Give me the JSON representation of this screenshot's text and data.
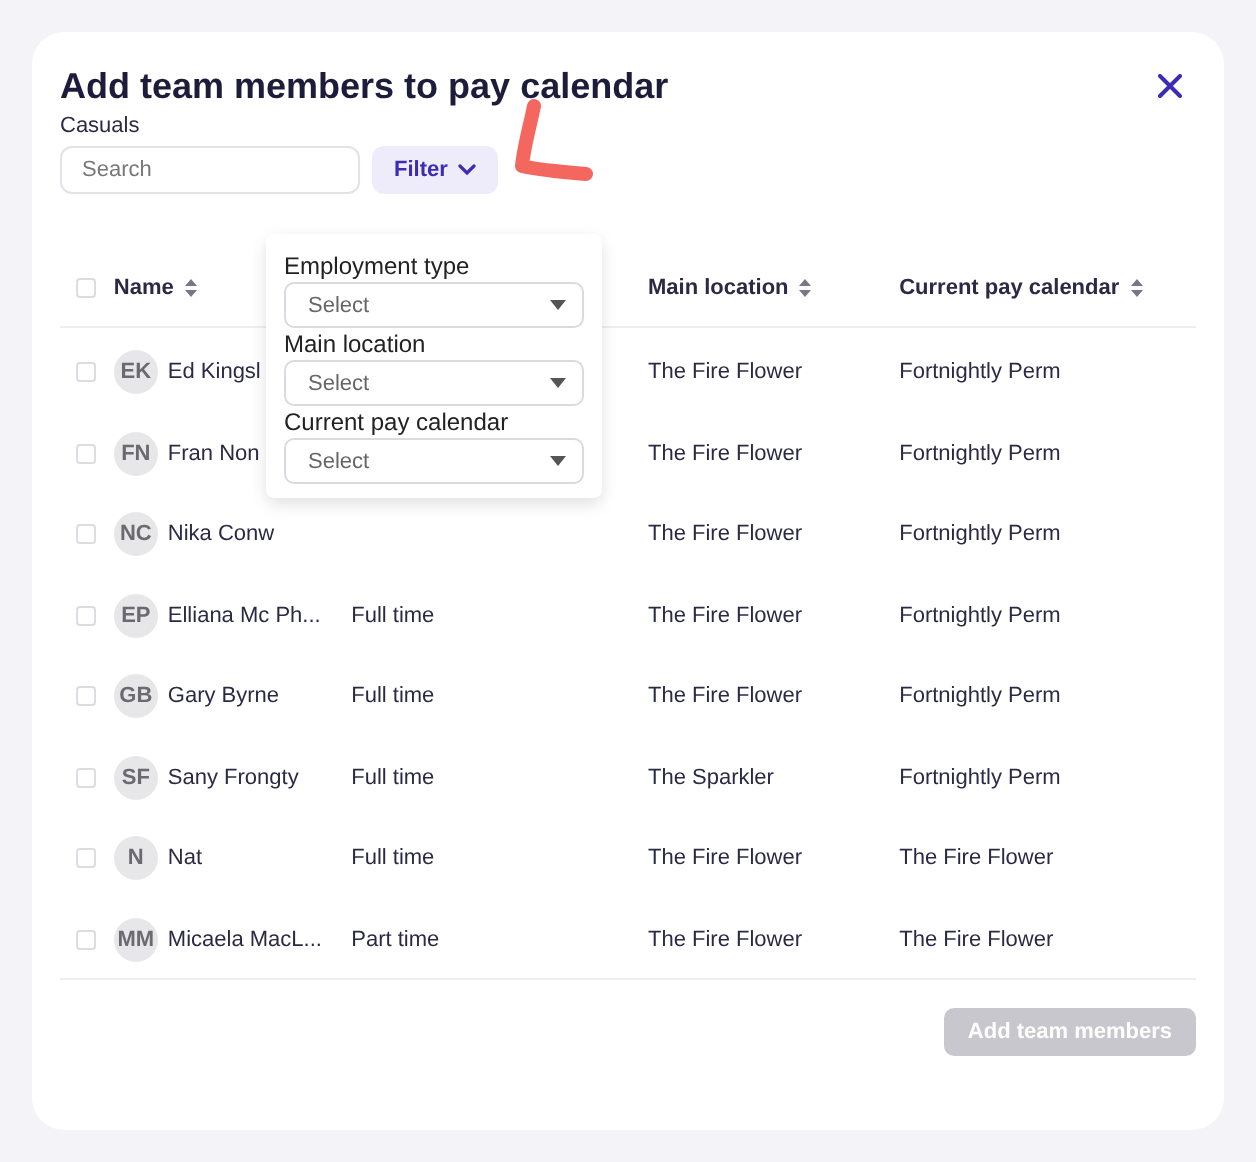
{
  "dialog": {
    "title": "Add team members to pay calendar",
    "subtitle": "Casuals"
  },
  "search": {
    "placeholder": "Search"
  },
  "filter_button": {
    "label": "Filter",
    "expanded": true
  },
  "filter_menu": {
    "fields": [
      {
        "label": "Employment type",
        "placeholder": "Select"
      },
      {
        "label": "Main location",
        "placeholder": "Select"
      },
      {
        "label": "Current pay calendar",
        "placeholder": "Select"
      }
    ]
  },
  "table": {
    "select_all_checked": false,
    "columns": [
      {
        "label": "Name"
      },
      {
        "label": "Main location"
      },
      {
        "label": "Current pay calendar"
      }
    ],
    "rows": [
      {
        "checked": false,
        "initials": "EK",
        "name": "Ed Kingsl",
        "location": "The Fire Flower",
        "calendar": "Fortnightly Perm"
      },
      {
        "checked": false,
        "initials": "FN",
        "name": "Fran Non",
        "location": "The Fire Flower",
        "calendar": "Fortnightly Perm"
      },
      {
        "checked": false,
        "initials": "NC",
        "name": "Nika Conw",
        "location": "The Fire Flower",
        "calendar": "Fortnightly Perm"
      },
      {
        "checked": false,
        "initials": "EP",
        "name": "Elliana Mc Ph...",
        "employment": "Full time",
        "location": "The Fire Flower",
        "calendar": "Fortnightly Perm"
      },
      {
        "checked": false,
        "initials": "GB",
        "name": "Gary Byrne",
        "employment": "Full time",
        "location": "The Fire Flower",
        "calendar": "Fortnightly Perm"
      },
      {
        "checked": false,
        "initials": "SF",
        "name": "Sany Frongty",
        "employment": "Full time",
        "location": "The Sparkler",
        "calendar": "Fortnightly Perm"
      },
      {
        "checked": false,
        "initials": "N",
        "name": "Nat",
        "employment": "Full time",
        "location": "The Fire Flower",
        "calendar": "The Fire Flower"
      },
      {
        "checked": false,
        "initials": "MM",
        "name": "Micaela MacL...",
        "employment": "Part time",
        "location": "The Fire Flower",
        "calendar": "The Fire Flower"
      }
    ]
  },
  "footer": {
    "button": {
      "label": "Add team members",
      "disabled": true
    }
  }
}
